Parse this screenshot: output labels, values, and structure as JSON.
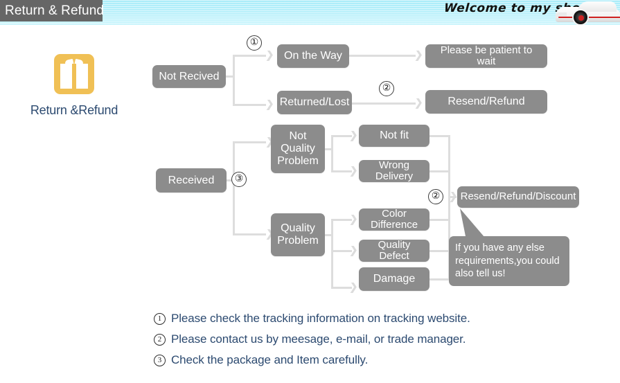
{
  "banner": {
    "tab_label": "Return & Refund",
    "welcome_text": "Welcome to my shop",
    "car_icon": "sports-car-image",
    "bg_color": "#b8f0fb",
    "tab_color": "#666666"
  },
  "icon_block": {
    "icon": "gift-box-icon",
    "icon_color": "#f0c055",
    "label": "Return &Refund",
    "label_color": "#2c4a70"
  },
  "flow": {
    "node_color": "#8c8c8c",
    "line_color": "#dddddd",
    "nodes": {
      "not_recived": "Not Recived",
      "on_the_way": "On the Way",
      "returned_lost": "Returned/Lost",
      "please_wait": "Please be patient to wait",
      "resend_refund": "Resend/Refund",
      "received": "Received",
      "not_quality_problem": "Not\nQuality\nProblem",
      "quality_problem": "Quality\nProblem",
      "not_fit": "Not fit",
      "wrong_delivery": "Wrong Delivery",
      "color_difference": "Color Difference",
      "quality_defect": "Quality Defect",
      "damage": "Damage",
      "resend_refund_discount": "Resend/Refund/Discount"
    },
    "markers": {
      "m1": "①",
      "m2": "②",
      "m3": "③",
      "m2b": "②"
    },
    "bubble": "If you have any else requirements,you could also tell us!"
  },
  "notes": [
    {
      "num": "1",
      "text": "Please check the tracking information on tracking website."
    },
    {
      "num": "2",
      "text": "Please contact us by meesage, e-mail, or trade manager."
    },
    {
      "num": "3",
      "text": "Check the package and Item carefully."
    }
  ]
}
